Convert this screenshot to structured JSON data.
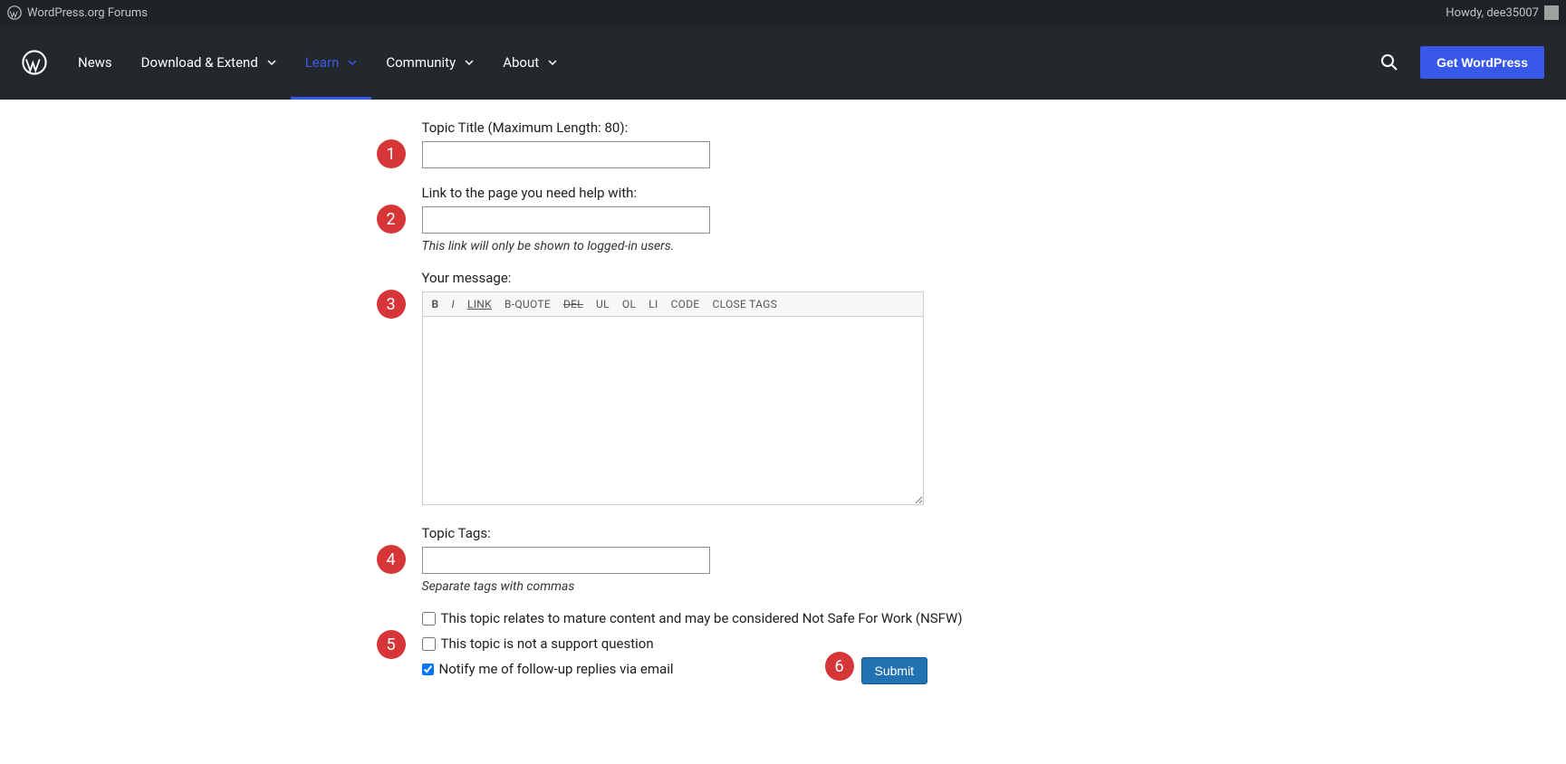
{
  "admin_bar": {
    "site_title": "WordPress.org Forums",
    "howdy": "Howdy, dee35007"
  },
  "nav": {
    "items": [
      {
        "label": "News",
        "has_submenu": false
      },
      {
        "label": "Download & Extend",
        "has_submenu": true
      },
      {
        "label": "Learn",
        "has_submenu": true
      },
      {
        "label": "Community",
        "has_submenu": true
      },
      {
        "label": "About",
        "has_submenu": true
      }
    ],
    "cta": "Get WordPress"
  },
  "form": {
    "title_label": "Topic Title (Maximum Length: 80):",
    "link_label": "Link to the page you need help with:",
    "link_help": "This link will only be shown to logged-in users.",
    "message_label": "Your message:",
    "toolbar": {
      "b": "B",
      "i": "I",
      "link": "LINK",
      "bquote": "B-QUOTE",
      "del": "DEL",
      "ul": "UL",
      "ol": "OL",
      "li": "LI",
      "code": "CODE",
      "close": "CLOSE TAGS"
    },
    "tags_label": "Topic Tags:",
    "tags_help": "Separate tags with commas",
    "nsfw_label": "This topic relates to mature content and may be considered Not Safe For Work (NSFW)",
    "not_support_label": "This topic is not a support question",
    "notify_label": "Notify me of follow-up replies via email",
    "submit": "Submit"
  },
  "annotations": {
    "n1": "1",
    "n2": "2",
    "n3": "3",
    "n4": "4",
    "n5": "5",
    "n6": "6"
  }
}
